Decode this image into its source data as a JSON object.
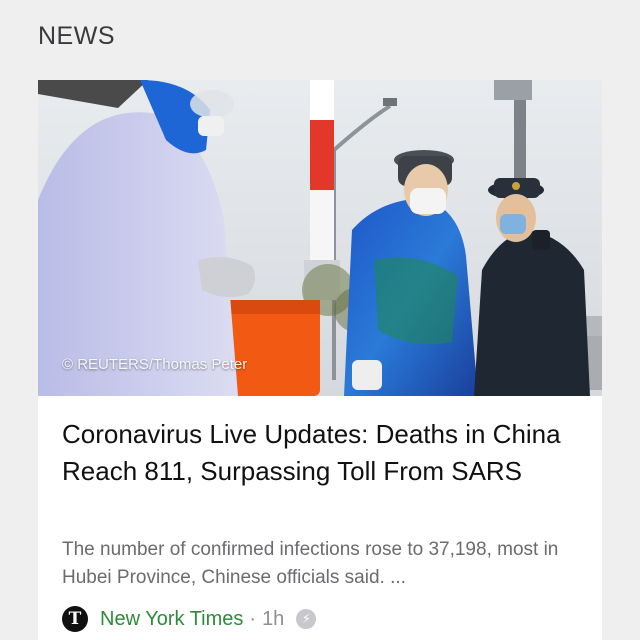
{
  "section": {
    "label": "NEWS"
  },
  "article": {
    "photo_alt": "Health workers in protective suits and police officers at a checkpoint",
    "credit": "© REUTERS/Thomas Peter",
    "headline": "Coronavirus Live Updates: Deaths in China Reach 811, Surpassing Toll From SARS",
    "summary": "The number of confirmed infections rose to 37,198, most in Hubei Province, Chinese officials said. ...",
    "source": {
      "logo_letter": "T",
      "name": "New York Times",
      "separator": "·",
      "age": "1h",
      "badge_icon": "bolt-icon"
    }
  },
  "colors": {
    "source_green": "#2e8b3a",
    "meta_gray": "#8e8e93",
    "summary_gray": "#6b6b70"
  }
}
